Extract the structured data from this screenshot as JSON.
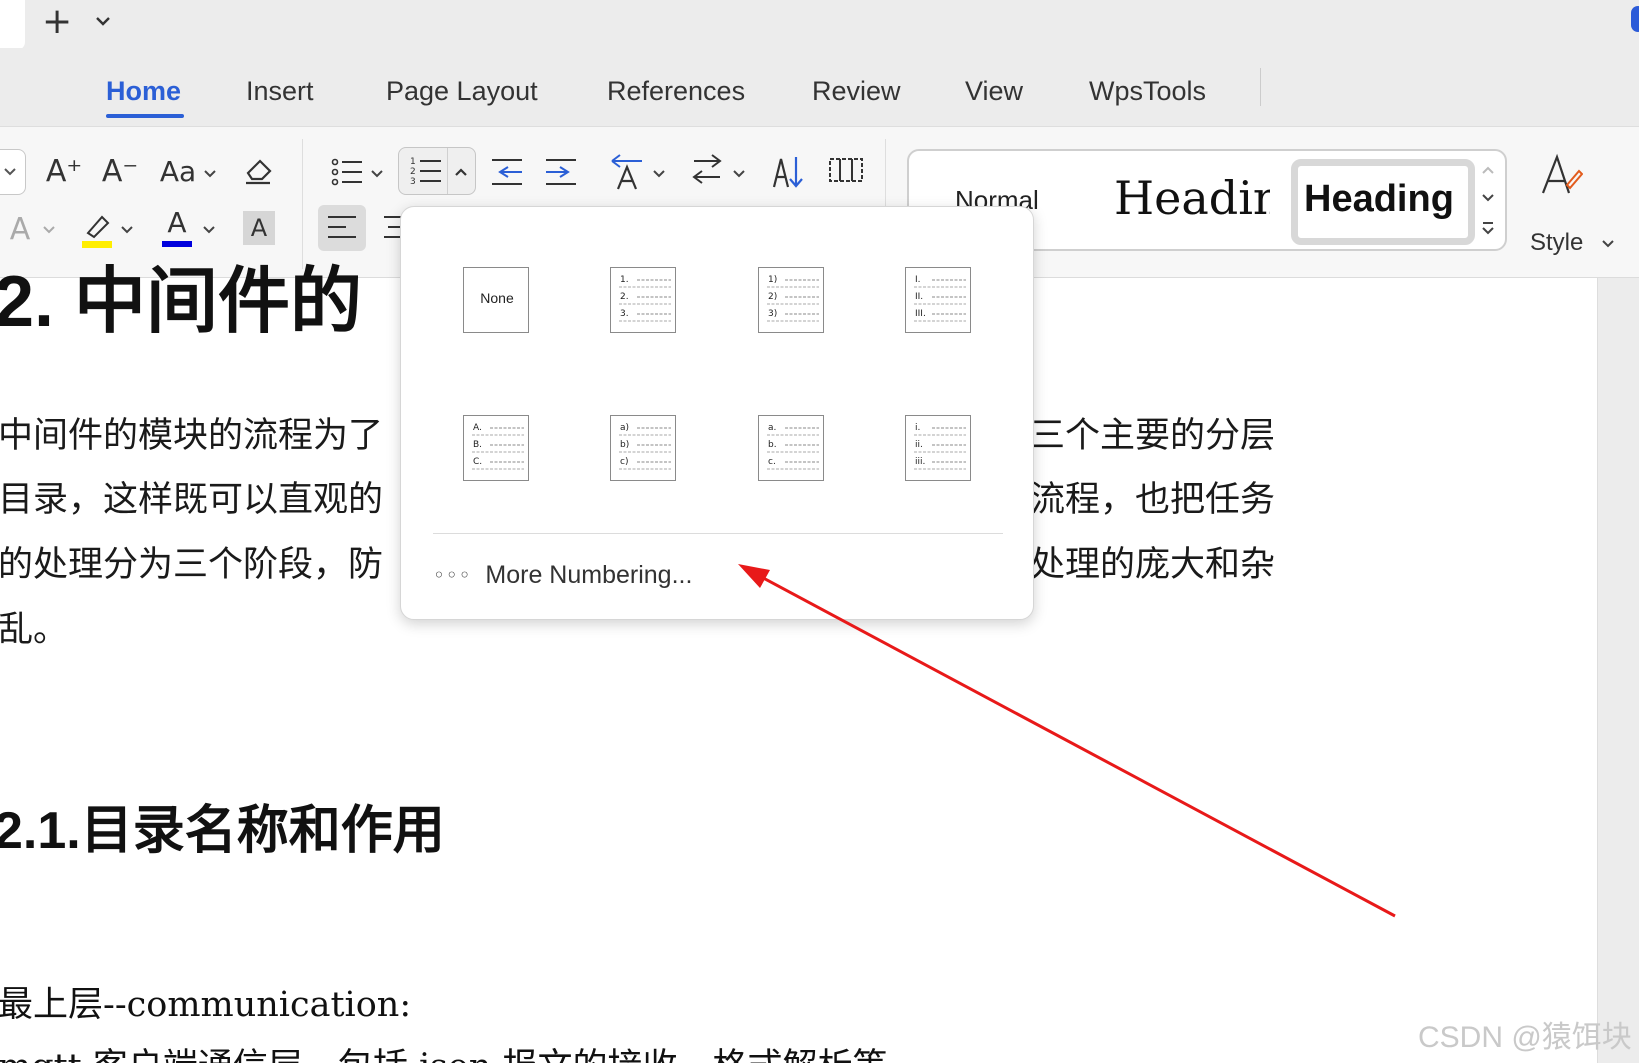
{
  "titlebar": {
    "new_tab_icon": "plus-icon",
    "new_tab_glyph": "+"
  },
  "menu": {
    "tabs": [
      {
        "label": "Home",
        "active": true
      },
      {
        "label": "Insert"
      },
      {
        "label": "Page Layout"
      },
      {
        "label": "References"
      },
      {
        "label": "Review"
      },
      {
        "label": "View"
      },
      {
        "label": "WpsTools"
      }
    ],
    "accent_color": "#2b5fd6"
  },
  "ribbon": {
    "font_grow": "A⁺",
    "font_shrink": "A⁻",
    "change_case": "Aa",
    "font_color_glyph": "A",
    "char_shading_glyph": "A",
    "text_effect_glyph": "A",
    "highlight_color": "#ffee00",
    "font_color": "#0000dd",
    "styles": {
      "normal": "Normal",
      "heading1": "Heading",
      "heading2": "Heading",
      "style_label": "Style"
    }
  },
  "document": {
    "heading1": "2. 中间件的",
    "para_left": [
      "中间件的模块的流程为了",
      "目录，这样既可以直观的",
      "的处理分为三个阶段，防",
      "乱。"
    ],
    "para_right": [
      "三个主要的分层",
      "流程，也把任务",
      "处理的庞大和杂"
    ],
    "heading2": "2.1.目录名称和作用",
    "line1": "最上层--communication:",
    "line2": "mqtt 客户端通信层，包括 json 报文的接收，格式解析等"
  },
  "numbering_dropdown": {
    "none_label": "None",
    "options": [
      {
        "id": "none"
      },
      {
        "id": "decimal-dot",
        "markers": [
          "1.",
          "2.",
          "3."
        ]
      },
      {
        "id": "decimal-paren",
        "markers": [
          "1)",
          "2)",
          "3)"
        ]
      },
      {
        "id": "roman-upper",
        "markers": [
          "I.",
          "II.",
          "III."
        ]
      },
      {
        "id": "alpha-upper",
        "markers": [
          "A.",
          "B.",
          "C."
        ]
      },
      {
        "id": "alpha-lower-paren",
        "markers": [
          "a)",
          "b)",
          "c)"
        ]
      },
      {
        "id": "alpha-lower-dot",
        "markers": [
          "a.",
          "b.",
          "c."
        ]
      },
      {
        "id": "roman-lower",
        "markers": [
          "i.",
          "ii.",
          "iii."
        ]
      }
    ],
    "more_icon": "more-dots-icon",
    "more_dots": "◦◦◦",
    "more_label": "More Numbering..."
  },
  "annotation": {
    "arrow_color": "#e81919"
  },
  "watermark": "CSDN @猿饵块"
}
